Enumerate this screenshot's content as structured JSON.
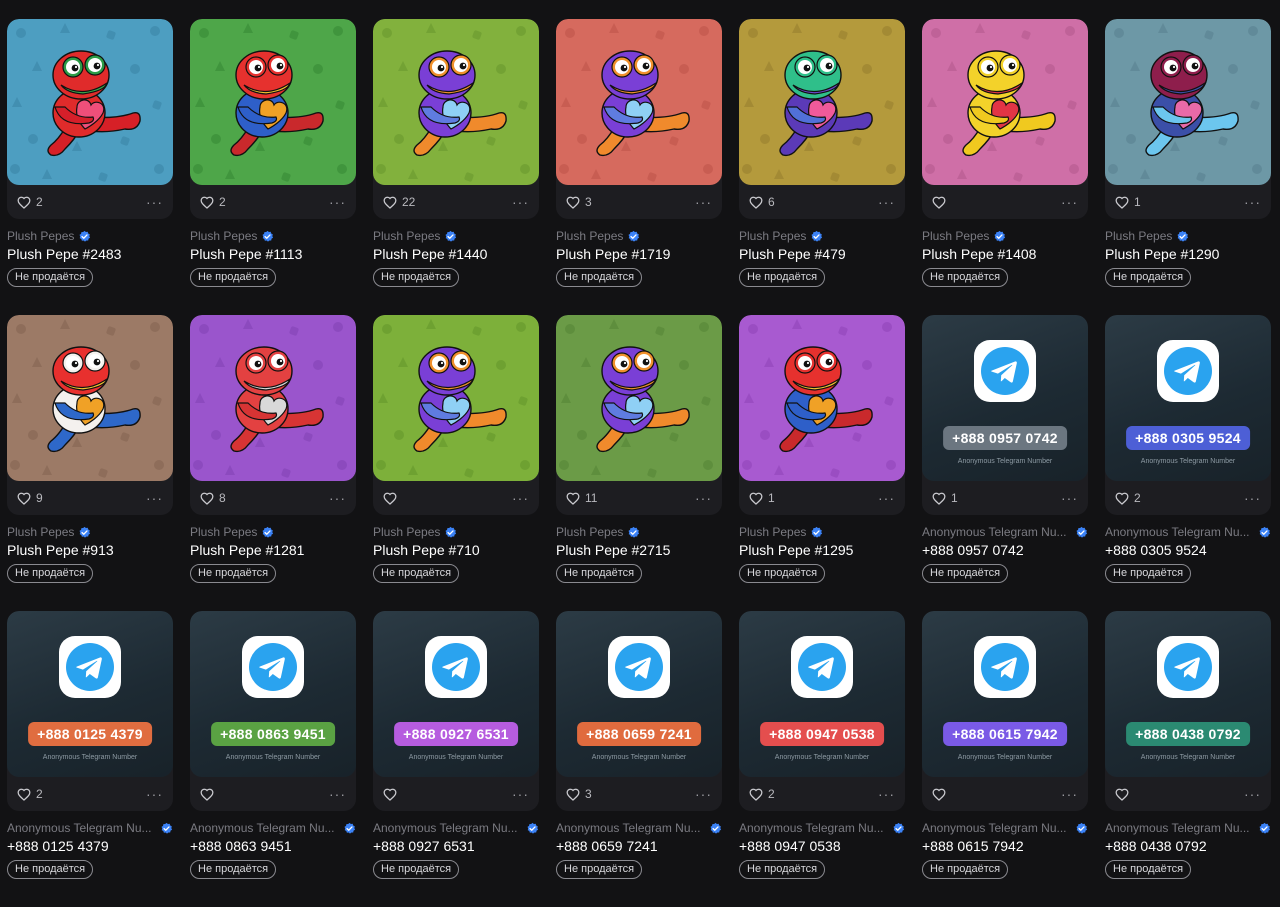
{
  "colors": {
    "background": "#121214",
    "card_footer": "#1d1d21",
    "verified": "#3b82f6",
    "telegram_blue": "#2aa3ef"
  },
  "cards": [
    {
      "type": "pepe",
      "bg": "#4d9ec1",
      "pattern": "#3f89ab",
      "body": "#e02b2b",
      "belly": "#ef4f7a",
      "head": "#e02b2b",
      "mouth": "#3aa84a",
      "eye_ring": "#2c9c46",
      "arms": "#d51f2a",
      "legs": "#d62027",
      "likes": "2",
      "collection": "Plush Pepes",
      "title": "Plush Pepe #2483",
      "status": "Не продаётся"
    },
    {
      "type": "pepe",
      "bg": "#4ea649",
      "pattern": "#3c8f3a",
      "body": "#2e5fc9",
      "belly": "#f0a126",
      "head": "#e6312e",
      "mouth": "#f2c230",
      "eye_ring": "#e6312e",
      "arms": "#2e5fc9",
      "legs": "#c9292c",
      "likes": "2",
      "collection": "Plush Pepes",
      "title": "Plush Pepe #1113",
      "status": "Не продаётся"
    },
    {
      "type": "pepe",
      "bg": "#82b13d",
      "pattern": "#6e9d31",
      "body": "#7a3fd6",
      "belly": "#8fd0f5",
      "head": "#7a3fd6",
      "mouth": "#f0902c",
      "eye_ring": "#f0902c",
      "arms": "#5f7ce0",
      "legs": "#f08a2c",
      "likes": "22",
      "collection": "Plush Pepes",
      "title": "Plush Pepe #1440",
      "status": "Не продаётся"
    },
    {
      "type": "pepe",
      "bg": "#d66a5e",
      "pattern": "#c35a4f",
      "body": "#7a3fd6",
      "belly": "#8fd0f5",
      "head": "#7a3fd6",
      "mouth": "#f0902c",
      "eye_ring": "#f0902c",
      "arms": "#5f7ce0",
      "legs": "#f08a2c",
      "likes": "3",
      "collection": "Plush Pepes",
      "title": "Plush Pepe #1719",
      "status": "Не продаётся"
    },
    {
      "type": "pepe",
      "bg": "#b49a3c",
      "pattern": "#9d8431",
      "body": "#5b3ab8",
      "belly": "#f05a9a",
      "head": "#2fbf8a",
      "mouth": "#6a46c9",
      "eye_ring": "#2fbf8a",
      "arms": "#5170d8",
      "legs": "#5b3ab8",
      "likes": "6",
      "collection": "Plush Pepes",
      "title": "Plush Pepe #479",
      "status": "Не продаётся"
    },
    {
      "type": "pepe",
      "bg": "#cf6fa7",
      "pattern": "#b95e93",
      "body": "#f3d22a",
      "belly": "#e23545",
      "head": "#f3d22a",
      "mouth": "#e23545",
      "eye_ring": "#f3d22a",
      "arms": "#f0c91f",
      "legs": "#f0c91f",
      "likes": "",
      "collection": "Plush Pepes",
      "title": "Plush Pepe #1408",
      "status": "Не продаётся"
    },
    {
      "type": "pepe",
      "bg": "#6d98a6",
      "pattern": "#5d8694",
      "body": "#3b4fa8",
      "belly": "#e86aa8",
      "head": "#8e1e4c",
      "mouth": "#3b4fa8",
      "eye_ring": "#8e1e4c",
      "arms": "#6cc6ee",
      "legs": "#6cc6ee",
      "likes": "1",
      "collection": "Plush Pepes",
      "title": "Plush Pepe #1290",
      "status": "Не продаётся"
    },
    {
      "type": "pepe",
      "bg": "#9c7a66",
      "pattern": "#8a6a57",
      "body": "#f4f1ee",
      "belly": "#f0a126",
      "head": "#e8302e",
      "mouth": "#f2c230",
      "eye_ring": "#f4f1ee",
      "arms": "#2e68c9",
      "legs": "#2e68c9",
      "likes": "9",
      "collection": "Plush Pepes",
      "title": "Plush Pepe #913",
      "status": "Не продаётся"
    },
    {
      "type": "pepe",
      "bg": "#9a55cc",
      "pattern": "#8747b9",
      "body": "#e34141",
      "belly": "#d9d9d9",
      "head": "#e34141",
      "mouth": "#d9d9d9",
      "eye_ring": "#e34141",
      "arms": "#d73434",
      "legs": "#d73434",
      "likes": "8",
      "collection": "Plush Pepes",
      "title": "Plush Pepe #1281",
      "status": "Не продаётся"
    },
    {
      "type": "pepe",
      "bg": "#7db03a",
      "pattern": "#6a9c2f",
      "body": "#7a3fd6",
      "belly": "#8fd0f5",
      "head": "#7a3fd6",
      "mouth": "#f0902c",
      "eye_ring": "#f0902c",
      "arms": "#5f7ce0",
      "legs": "#f08a2c",
      "likes": "",
      "collection": "Plush Pepes",
      "title": "Plush Pepe #710",
      "status": "Не продаётся"
    },
    {
      "type": "pepe",
      "bg": "#6b9b47",
      "pattern": "#5a8a3a",
      "body": "#7a3fd6",
      "belly": "#8fd0f5",
      "head": "#7a3fd6",
      "mouth": "#f0902c",
      "eye_ring": "#f0902c",
      "arms": "#5f7ce0",
      "legs": "#f08a2c",
      "likes": "11",
      "collection": "Plush Pepes",
      "title": "Plush Pepe #2715",
      "status": "Не продаётся"
    },
    {
      "type": "pepe",
      "bg": "#a85ad0",
      "pattern": "#954abd",
      "body": "#2e5fc9",
      "belly": "#f0a126",
      "head": "#e6312e",
      "mouth": "#f2c230",
      "eye_ring": "#e6312e",
      "arms": "#2e5fc9",
      "legs": "#c9292c",
      "likes": "1",
      "collection": "Plush Pepes",
      "title": "Plush Pepe #1295",
      "status": "Не продаётся"
    },
    {
      "type": "phone",
      "number": "+888 0957 0742",
      "pill": "#6b7680",
      "caption": "Anonymous Telegram Number",
      "likes": "1",
      "collection": "Anonymous Telegram Nu...",
      "title": "+888 0957 0742",
      "status": "Не продаётся"
    },
    {
      "type": "phone",
      "number": "+888 0305 9524",
      "pill": "#4d5fd6",
      "caption": "Anonymous Telegram Number",
      "likes": "2",
      "collection": "Anonymous Telegram Nu...",
      "title": "+888 0305 9524",
      "status": "Не продаётся"
    },
    {
      "type": "phone",
      "number": "+888 0125 4379",
      "pill": "#e06d40",
      "caption": "Anonymous Telegram Number",
      "likes": "2",
      "collection": "Anonymous Telegram Nu...",
      "title": "+888 0125 4379",
      "status": "Не продаётся"
    },
    {
      "type": "phone",
      "number": "+888 0863 9451",
      "pill": "#5aa243",
      "caption": "Anonymous Telegram Number",
      "likes": "",
      "collection": "Anonymous Telegram Nu...",
      "title": "+888 0863 9451",
      "status": "Не продаётся"
    },
    {
      "type": "phone",
      "number": "+888 0927 6531",
      "pill": "#b65cdf",
      "caption": "Anonymous Telegram Number",
      "likes": "",
      "collection": "Anonymous Telegram Nu...",
      "title": "+888 0927 6531",
      "status": "Не продаётся"
    },
    {
      "type": "phone",
      "number": "+888 0659 7241",
      "pill": "#e06b3e",
      "caption": "Anonymous Telegram Number",
      "likes": "3",
      "collection": "Anonymous Telegram Nu...",
      "title": "+888 0659 7241",
      "status": "Не продаётся"
    },
    {
      "type": "phone",
      "number": "+888 0947 0538",
      "pill": "#e44e4e",
      "caption": "Anonymous Telegram Number",
      "likes": "2",
      "collection": "Anonymous Telegram Nu...",
      "title": "+888 0947 0538",
      "status": "Не продаётся"
    },
    {
      "type": "phone",
      "number": "+888 0615 7942",
      "pill": "#7a5ae6",
      "caption": "Anonymous Telegram Number",
      "likes": "",
      "collection": "Anonymous Telegram Nu...",
      "title": "+888 0615 7942",
      "status": "Не продаётся"
    },
    {
      "type": "phone",
      "number": "+888 0438 0792",
      "pill": "#2b8a72",
      "caption": "Anonymous Telegram Number",
      "likes": "",
      "collection": "Anonymous Telegram Nu...",
      "title": "+888 0438 0792",
      "status": "Не продаётся"
    }
  ],
  "icons": {
    "like": "heart-icon",
    "more": "more-icon",
    "verified": "verified-icon",
    "telegram": "telegram-icon"
  }
}
